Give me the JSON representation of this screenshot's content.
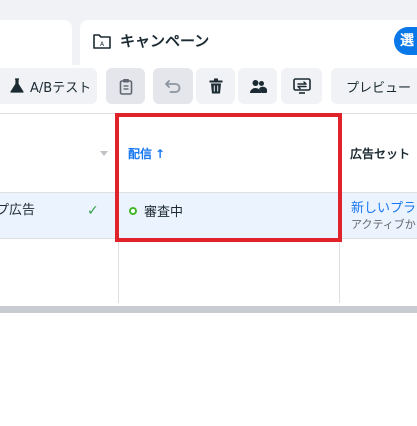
{
  "tabs": {
    "campaign_title": "キャンペーン",
    "select_pill": "選"
  },
  "toolbar": {
    "ab_test_label": "A/Bテスト",
    "preview_label": "プレビュー"
  },
  "table": {
    "header_delivery": "配信",
    "header_delivery_arrow": "↑",
    "header_adset": "広告セット",
    "row": {
      "ad_name": "プ広告",
      "delivery_status": "審査中",
      "adset_name": "新しいプラ",
      "adset_status": "アクティブか"
    }
  },
  "colors": {
    "accent_blue": "#1877f2",
    "highlight_red": "#e0232b",
    "status_green": "#42b72a",
    "selected_row": "#ebf3ff"
  },
  "icons": [
    "folder-icon",
    "flask-icon",
    "clipboard-icon",
    "undo-icon",
    "trash-icon",
    "people-icon",
    "swap-icon",
    "check-icon",
    "status-dot-icon",
    "sort-caret-icon"
  ]
}
